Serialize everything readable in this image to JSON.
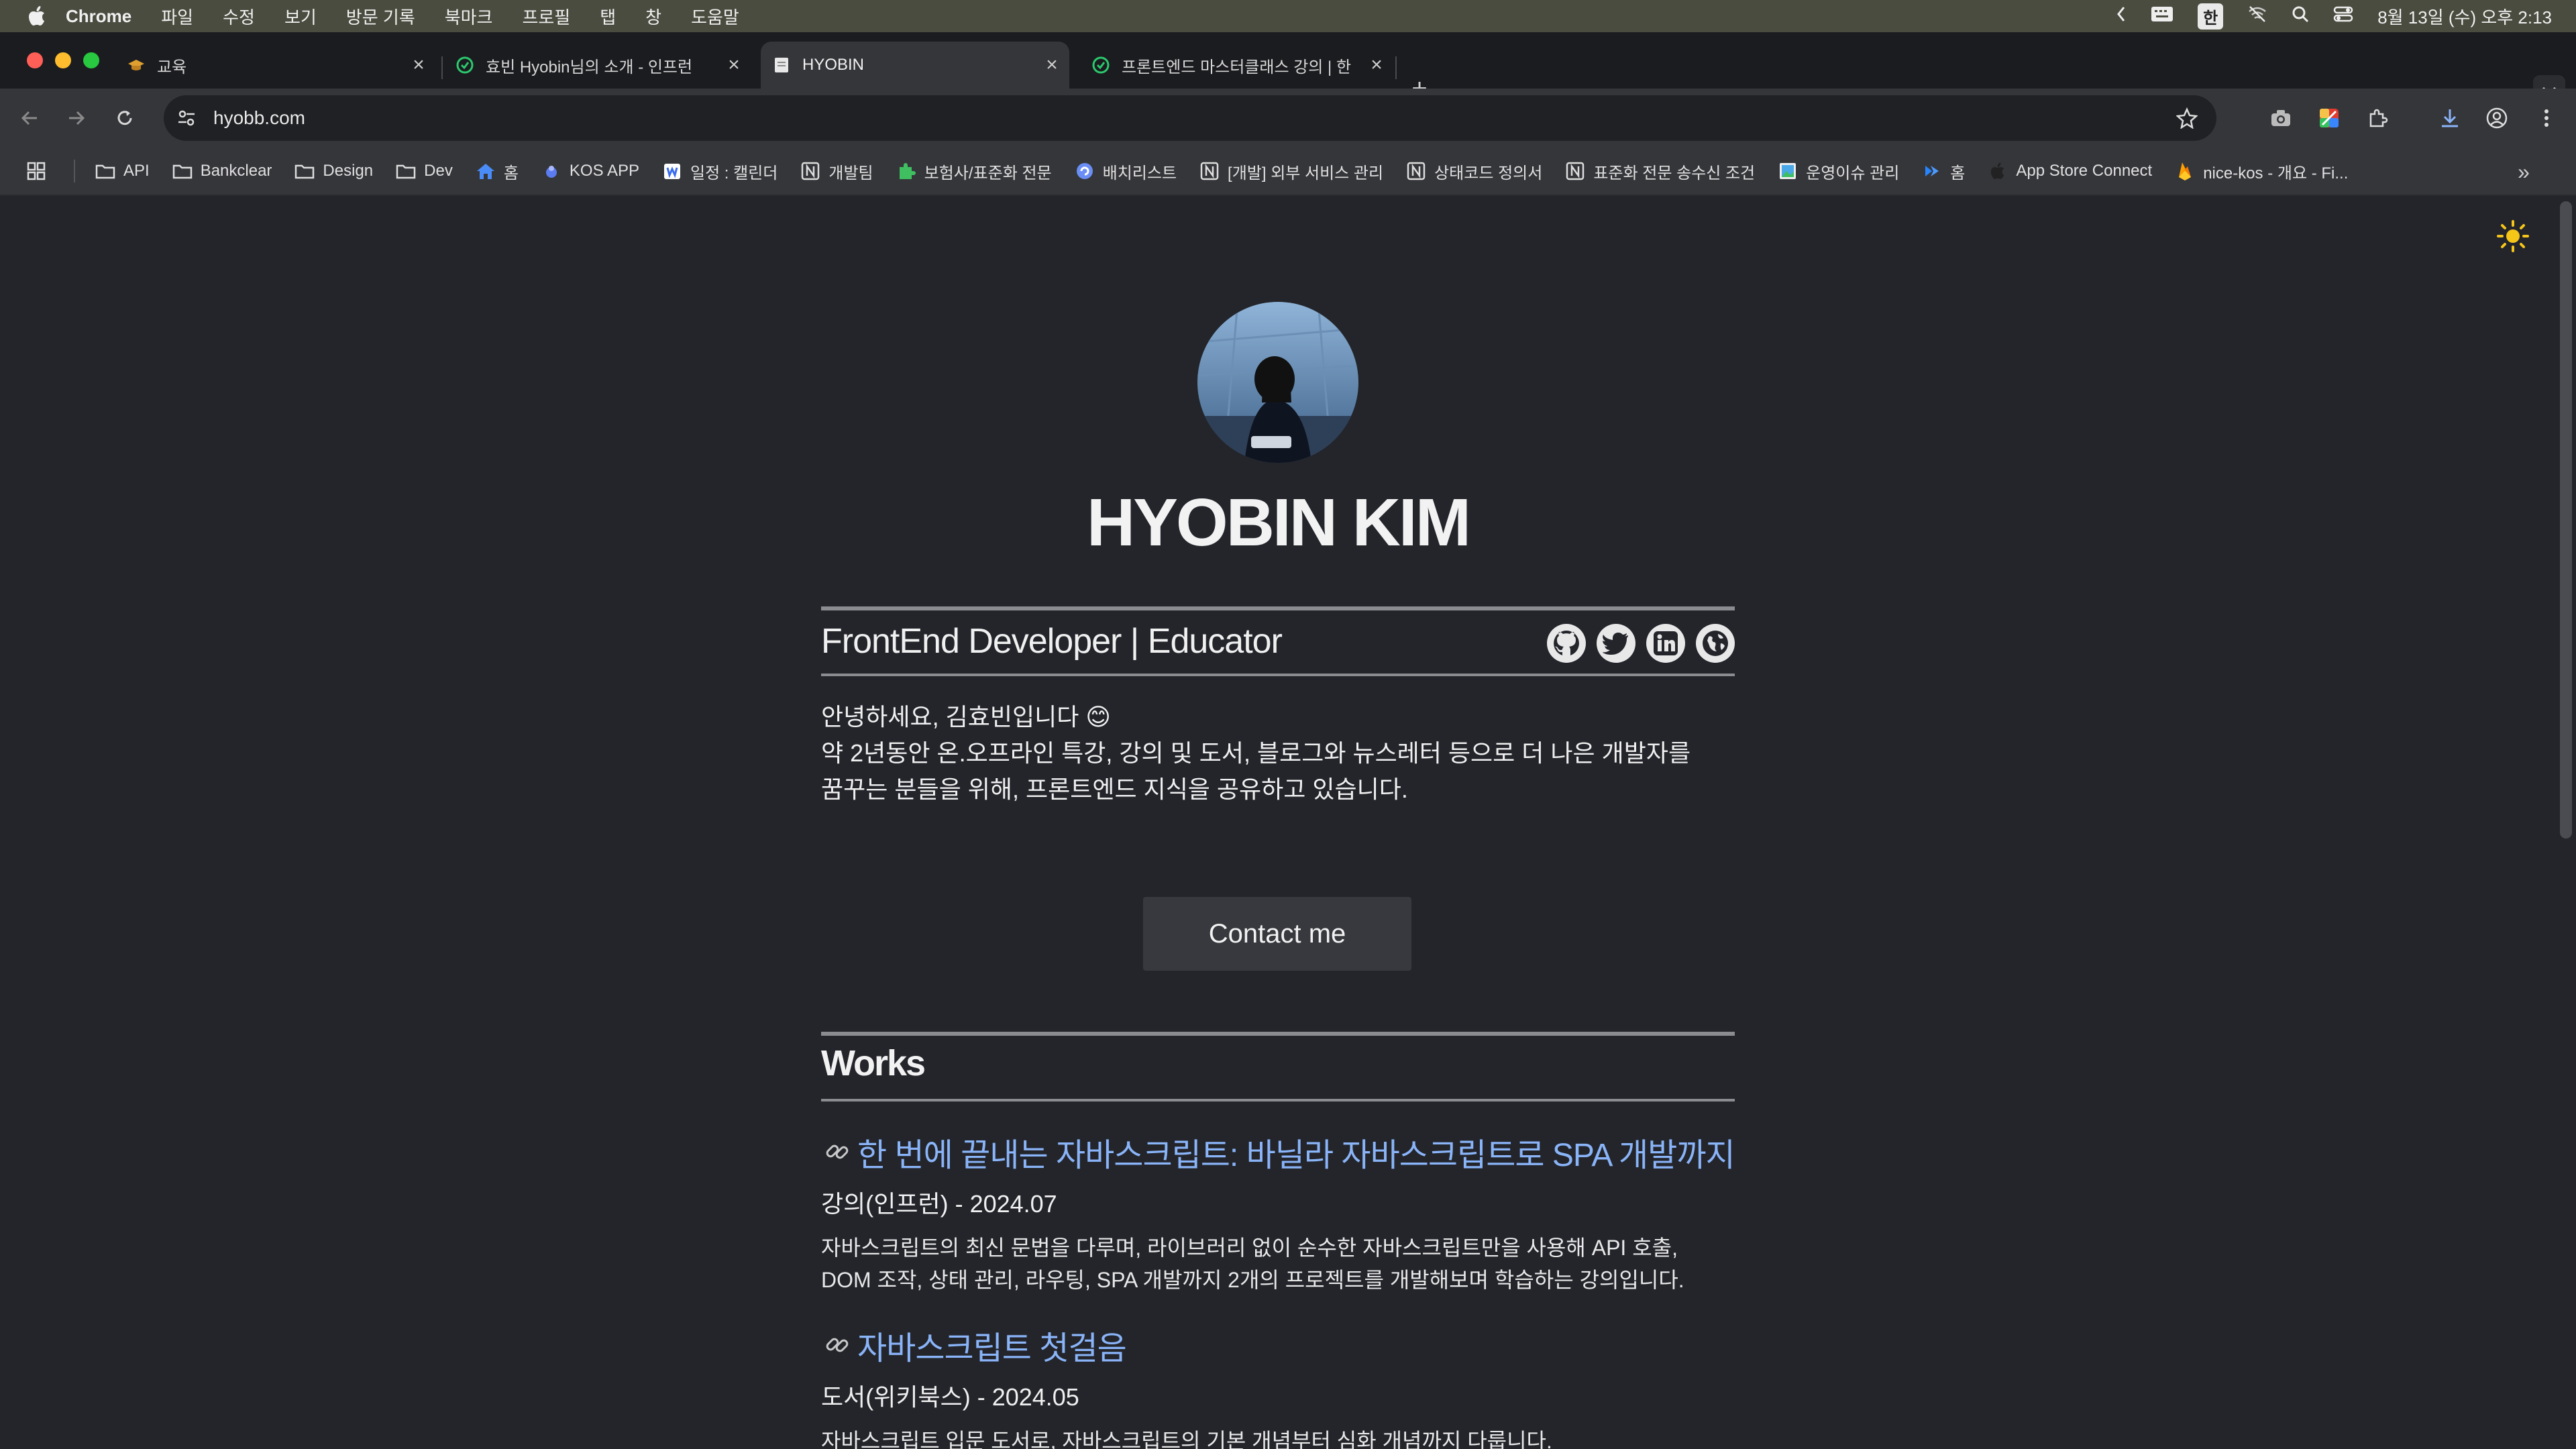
{
  "menubar": {
    "app": "Chrome",
    "items": [
      "파일",
      "수정",
      "보기",
      "방문 기록",
      "북마크",
      "프로필",
      "탭",
      "창",
      "도움말"
    ],
    "ime": "한",
    "datetime": "8월 13일 (수) 오후 2:13"
  },
  "tabs": [
    {
      "title": "교육",
      "active": false
    },
    {
      "title": "효빈 Hyobin님의 소개 - 인프런",
      "active": false
    },
    {
      "title": "HYOBIN",
      "active": true
    },
    {
      "title": "프론트엔드 마스터클래스 강의 | 한",
      "active": false
    }
  ],
  "toolbar": {
    "url": "hyobb.com"
  },
  "bookmarks": [
    {
      "label": "API",
      "icon": "folder-icon"
    },
    {
      "label": "Bankclear",
      "icon": "folder-icon"
    },
    {
      "label": "Design",
      "icon": "folder-icon"
    },
    {
      "label": "Dev",
      "icon": "folder-icon"
    },
    {
      "label": "홈",
      "icon": "home-icon"
    },
    {
      "label": "KOS APP",
      "icon": "app-icon"
    },
    {
      "label": "일정 : 캘린더",
      "icon": "calendar-icon"
    },
    {
      "label": "개발팀",
      "icon": "notion-icon"
    },
    {
      "label": "보험사/표준화 전문",
      "icon": "puzzle-icon"
    },
    {
      "label": "배치리스트",
      "icon": "batch-icon"
    },
    {
      "label": "[개발] 외부 서비스 관리",
      "icon": "notion-icon"
    },
    {
      "label": "상태코드 정의서",
      "icon": "notion-icon"
    },
    {
      "label": "표준화 전문 송수신 조건",
      "icon": "notion-icon"
    },
    {
      "label": "운영이슈 관리",
      "icon": "image-icon"
    },
    {
      "label": "홈",
      "icon": "jira-icon"
    },
    {
      "label": "App Store Connect",
      "icon": "apple-icon"
    },
    {
      "label": "nice-kos - 개요 - Fi...",
      "icon": "firebase-icon"
    }
  ],
  "profile": {
    "name": "HYOBIN KIM",
    "subtitle": "FrontEnd Developer | Educator",
    "intro_line1": "안녕하세요, 김효빈입니다 😊",
    "intro_line2": "약 2년동안 온.오프라인 특강, 강의 및 도서, 블로그와 뉴스레터 등으로 더 나은 개발자를",
    "intro_line3": "꿈꾸는 분들을 위해, 프론트엔드 지식을 공유하고 있습니다.",
    "contact_label": "Contact me"
  },
  "works": {
    "title": "Works",
    "items": [
      {
        "title": "한 번에 끝내는 자바스크립트: 바닐라 자바스크립트로 SPA 개발까지",
        "meta": "강의(인프런) - 2024.07",
        "desc1": "자바스크립트의 최신 문법을 다루며, 라이브러리 없이 순수한 자바스크립트만을 사용해 API 호출,",
        "desc2": "DOM 조작, 상태 관리, 라우팅, SPA 개발까지 2개의 프로젝트를 개발해보며 학습하는 강의입니다."
      },
      {
        "title": "자바스크립트 첫걸음",
        "meta": "도서(위키북스) - 2024.05",
        "desc1": "자바스크립트 입문 도서로, 자바스크립트의 기본 개념부터 심화 개념까지 다룹니다.",
        "desc2": ""
      }
    ]
  },
  "colors": {
    "page_bg": "#23252b",
    "link": "#8ab4f8",
    "menubar_bg": "#4a4c3f"
  }
}
